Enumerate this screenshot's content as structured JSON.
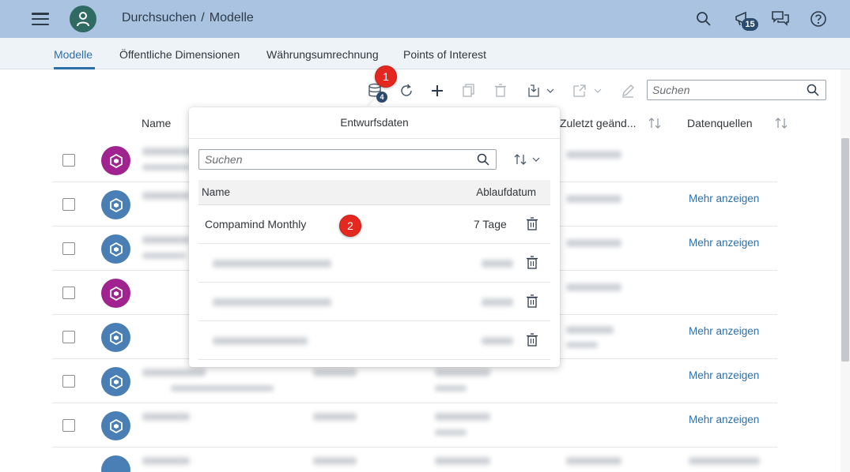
{
  "shell": {
    "breadcrumb": [
      "Durchsuchen",
      "/",
      "Modelle"
    ],
    "notification_count": "15",
    "colors": {
      "bar": "#a9c3e0",
      "avatar": "#2f6a63",
      "accent": "#2c6fa8",
      "marker": "#e3281f"
    }
  },
  "tabs": [
    {
      "label": "Modelle",
      "active": true
    },
    {
      "label": "Öffentliche Dimensionen",
      "active": false
    },
    {
      "label": "Währungsumrechnung",
      "active": false
    },
    {
      "label": "Points of Interest",
      "active": false
    }
  ],
  "toolbar": {
    "draft_badge": "4",
    "search_placeholder": "Suchen",
    "icons": [
      "draft-data-icon",
      "refresh-icon",
      "add-icon",
      "copy-icon",
      "delete-icon",
      "import-icon",
      "export-icon",
      "edit-icon"
    ]
  },
  "markers": [
    "1",
    "2"
  ],
  "table": {
    "headers": {
      "name": "Name",
      "modified": "Zuletzt geänd...",
      "sources": "Datenquellen"
    },
    "more_label": "Mehr anzeigen"
  },
  "popover": {
    "title": "Entwurfsdaten",
    "search_placeholder": "Suchen",
    "col_name": "Name",
    "col_expiry": "Ablaufdatum",
    "first_row": {
      "name": "Compamind Monthly",
      "expiry": "7 Tage"
    }
  }
}
